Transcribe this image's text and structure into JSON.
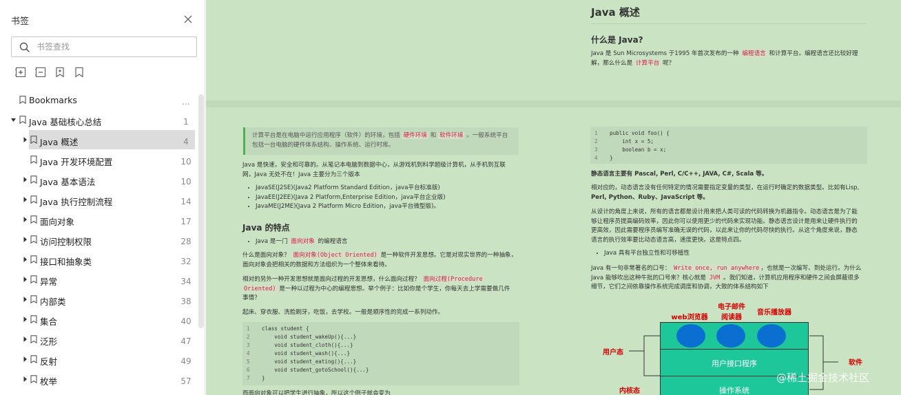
{
  "panel": {
    "title": "书签",
    "search_placeholder": "书签查找",
    "icons": {
      "close": "close-icon",
      "search": "search-icon",
      "toolbar": [
        "expand-all-icon",
        "collapse-all-icon",
        "add-bookmark-icon",
        "bookmark-icon"
      ]
    },
    "items": [
      {
        "label": "Bookmarks",
        "page": "...",
        "level": 0,
        "expand": "none"
      },
      {
        "label": "Java 基础核心总结",
        "page": "1",
        "level": 0,
        "expand": "expanded"
      },
      {
        "label": "Java 概述",
        "page": "4",
        "level": 1,
        "expand": "collapsed",
        "selected": true
      },
      {
        "label": "Java 开发环境配置",
        "page": "10",
        "level": 1,
        "expand": "none"
      },
      {
        "label": "Java 基本语法",
        "page": "10",
        "level": 1,
        "expand": "collapsed"
      },
      {
        "label": "Java 执行控制流程",
        "page": "14",
        "level": 1,
        "expand": "collapsed"
      },
      {
        "label": "面向对象",
        "page": "17",
        "level": 1,
        "expand": "collapsed"
      },
      {
        "label": "访问控制权限",
        "page": "28",
        "level": 1,
        "expand": "collapsed"
      },
      {
        "label": "接口和抽象类",
        "page": "32",
        "level": 1,
        "expand": "collapsed"
      },
      {
        "label": "异常",
        "page": "34",
        "level": 1,
        "expand": "collapsed"
      },
      {
        "label": "内部类",
        "page": "38",
        "level": 1,
        "expand": "collapsed"
      },
      {
        "label": "集合",
        "page": "40",
        "level": 1,
        "expand": "collapsed"
      },
      {
        "label": "泛形",
        "page": "47",
        "level": 1,
        "expand": "collapsed"
      },
      {
        "label": "反射",
        "page": "49",
        "level": 1,
        "expand": "collapsed"
      },
      {
        "label": "枚举",
        "page": "57",
        "level": 1,
        "expand": "collapsed"
      }
    ]
  },
  "doc": {
    "colors": {
      "background": "#cae3c3",
      "keyword": "#c7254e",
      "diagram_label": "#d60000",
      "diagram_box": "#1ec79a",
      "diagram_circle": "#0b6fd1"
    },
    "top": {
      "title": "Java 概述",
      "h_what": "什么是 Java?",
      "p_what_1": "Java 是 Sun Microsystems 于1995 年首次发布的一种",
      "kw_prog_lang": "编程语言",
      "p_what_2": "和计算平台。编程语言还比较好理",
      "p_what_3": "解，那么什么是",
      "kw_platform": "计算平台",
      "p_what_4": "呢？"
    },
    "left": {
      "quote_1": "计算平台是在电脑中运行应用程序（软件）的环境，包括",
      "kw_hw": "硬件环境",
      "quote_and": "和",
      "kw_sw": "软件环境",
      "quote_2": "。一般系统平台",
      "quote_3": "包括一台电脑的硬件体系结构、操作系统、运行时库。",
      "p_intro_1": "Java 是快速，安全和可靠的。从笔记本电脑到数据中心，从游戏机到科学超级计算机，从手机到互联",
      "p_intro_2": "网，Java 无处不在！Java 主要分为三个版本",
      "editions": [
        "JavaSE(J2SE)(Java2 Platform Standard Edition，java平台标准版)",
        "JavaEE(J2EE)(Java 2 Platform,Enterprise Edition，java平台企业版)",
        "JavaME(J2ME)(Java 2 Platform Micro Edition，java平台微型版)。"
      ],
      "h_features": "Java 的特点",
      "feat_1": "Java 是一门",
      "kw_oo": "面向对象",
      "feat_2": "的编程语言",
      "p_oo_1": "什么是面向对象？",
      "kw_oo_full": "面向对象(Object Oriented)",
      "p_oo_2": "是一种软件开发思想。它是对现实世界的一种抽象，",
      "p_oo_3": "面向对象会把相关的数据和方法组织为一个整体来看待。",
      "p_po_1": "相对的另外一种开发思想就是面向过程的开发思想，什么面向过程？",
      "kw_po_full": "面向过程(Procedure",
      "kw_po_full2": "Oriented)",
      "p_po_2": "是一种以过程为中心的编程思想。举个例子：比如你是个学生，你每天去上学需要做几件",
      "p_po_3": "事情？",
      "p_daily": "起床、穿衣服、洗脸刷牙，吃饭，去学校。一般是顺序性的完成一系列动作。",
      "code": [
        {
          "n": "1",
          "text": "class student {"
        },
        {
          "n": "2",
          "text": "    void student_wakeUp(){...}"
        },
        {
          "n": "3",
          "text": "    void student_cloth(){...}"
        },
        {
          "n": "4",
          "text": "    void student_wash(){...}"
        },
        {
          "n": "5",
          "text": "    void student_eating(){...}"
        },
        {
          "n": "6",
          "text": "    void student_gotoSchool(){...}"
        },
        {
          "n": "7",
          "text": "}"
        }
      ],
      "p_cut": "而面向对象可以把学生进行抽象，所以这个例子就会变为"
    },
    "right": {
      "code": [
        {
          "n": "1",
          "text": "public void foo() {"
        },
        {
          "n": "2",
          "text": "    int x = 5;"
        },
        {
          "n": "3",
          "text": "    boolean b = x;"
        },
        {
          "n": "4",
          "text": "}"
        }
      ],
      "p_static": "静态语言主要有 Pascal, Perl, C/C++, JAVA, C#, Scala 等。",
      "p_dyn_1": "相对应的，动态语言没有任何特定的情况需要指定变量的类型，在运行时确定的数据类型。比如有Lisp,",
      "p_dyn_2": "Perl, Python、Ruby、JavaScript 等。",
      "p_design_1": "从设计的角度上来说，所有的语言都是设计用来把人类可读的代码转换为机器指令。动态语言是为了能",
      "p_design_2": "够让程序员提高编码效率，因此你可以使用更少的代码来实现功能。静态语言设计是用来让硬件执行的",
      "p_design_3": "更高效，因此需要程序员编写准确无误的代码，以此来让你的代码尽快的执行。从这个角度来说，静态",
      "p_design_4": "语言的执行效率要比动态语言高，速度更快。这是特点四。",
      "bullet_platform": "Java 具有平台独立性和可移植性",
      "p_slogan_1": "Java 有一句非常著名的口号：",
      "kw_slogan": "Write once, run anywhere",
      "p_slogan_2": "，也就是一次编写、到处运行。为什么",
      "p_slogan_3": "Java 能够吹出这种牛批的口号来？核心就是",
      "kw_jvm": "JVM",
      "p_slogan_4": "。我们知道，计算机应用程序和硬件之间会屏蔽很多",
      "p_slogan_5": "细节，它们之间依靠操作系统完成调度和协调，大致的体系结构如下",
      "diagram": {
        "browser": "web浏览器",
        "mail_1": "电子邮件",
        "mail_2": "阅读器",
        "music": "音乐播放器",
        "user_mode": "用户态",
        "kernel_mode": "内核态",
        "software": "软件",
        "ui_program": "用户接口程序",
        "os": "操作系统"
      }
    },
    "watermark": "@稀土掘金技术社区"
  }
}
